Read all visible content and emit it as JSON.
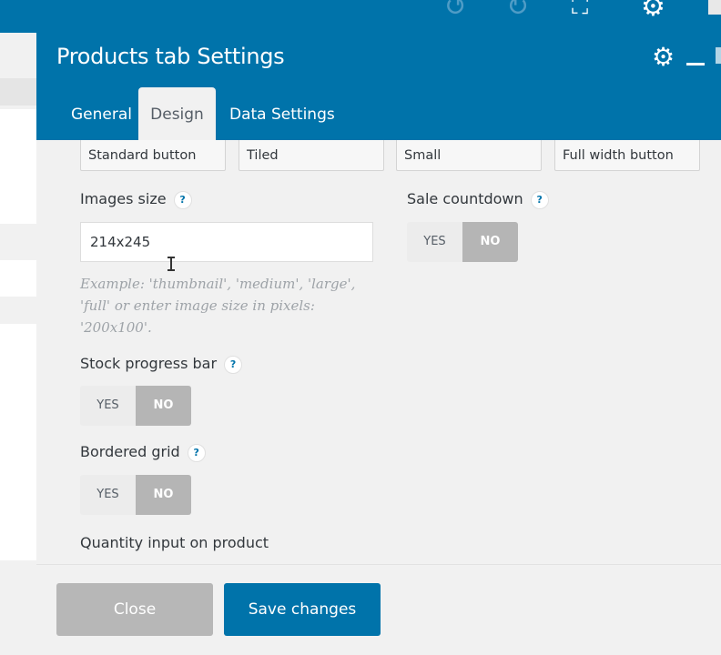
{
  "background": {
    "toolbar_icons": [
      "undo-icon",
      "redo-icon",
      "fullscreen-icon",
      "settings-gear-icon"
    ]
  },
  "modal": {
    "title": "Products tab Settings",
    "tabs": [
      {
        "label": "General",
        "active": false
      },
      {
        "label": "Design",
        "active": true
      },
      {
        "label": "Data Settings",
        "active": false
      }
    ],
    "option_buttons": [
      "Standard button",
      "Tiled",
      "Small",
      "Full width button"
    ],
    "images_size": {
      "label": "Images size",
      "value": "214x245",
      "hint": "Example: 'thumbnail', 'medium', 'large', 'full' or enter image size in pixels: '200x100'."
    },
    "sale_countdown": {
      "label": "Sale countdown",
      "yes": "YES",
      "no": "NO",
      "selected": "NO"
    },
    "stock_progress_bar": {
      "label": "Stock progress bar",
      "yes": "YES",
      "no": "NO",
      "selected": "NO"
    },
    "bordered_grid": {
      "label": "Bordered grid",
      "yes": "YES",
      "no": "NO",
      "selected": "NO"
    },
    "quantity_input": {
      "label": "Quantity input on product"
    },
    "help_glyph": "?",
    "footer": {
      "close_label": "Close",
      "save_label": "Save changes"
    }
  },
  "colors": {
    "brand_blue": "#0073aa",
    "panel_bg": "#f1f1f1",
    "toggle_selected": "#b5b5b5",
    "close_button": "#b7b7b7"
  }
}
